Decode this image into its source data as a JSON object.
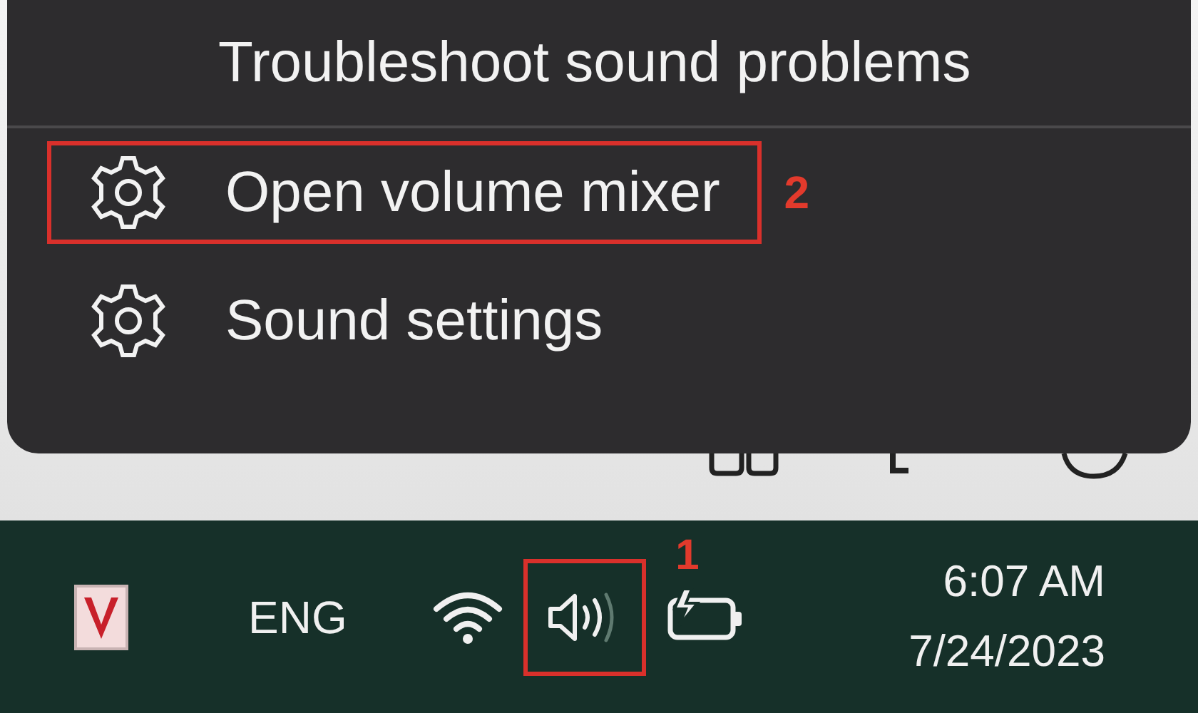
{
  "menu": {
    "items": [
      {
        "kind": "plain",
        "label": "Troubleshoot sound problems"
      },
      {
        "kind": "divider"
      },
      {
        "kind": "gear",
        "label": "Open volume mixer",
        "callout": "2"
      },
      {
        "kind": "gear",
        "label": "Sound settings"
      }
    ]
  },
  "taskbar": {
    "tray": [
      {
        "kind": "app"
      },
      {
        "kind": "text",
        "label": "ENG"
      },
      {
        "kind": "wifi"
      },
      {
        "kind": "volume",
        "callout": "1"
      },
      {
        "kind": "battery"
      }
    ],
    "clock": {
      "time": "6:07 AM",
      "date": "7/24/2023"
    }
  }
}
